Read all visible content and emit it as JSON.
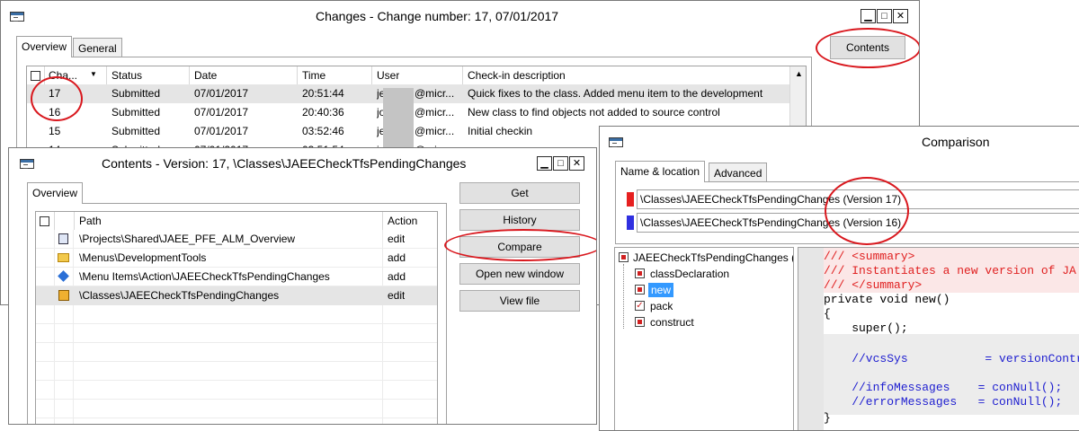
{
  "changes_window": {
    "title": "Changes - Change number: 17, 07/01/2017",
    "tabs": [
      "Overview",
      "General"
    ],
    "contents_button": "Contents",
    "columns": [
      "Cha...",
      "Status",
      "Date",
      "Time",
      "User",
      "Check-in description"
    ],
    "rows": [
      {
        "change": "17",
        "status": "Submitted",
        "date": "07/01/2017",
        "time": "20:51:44",
        "user": "je",
        "user_domain": "@micr...",
        "description": "Quick fixes to the class. Added menu item to the development"
      },
      {
        "change": "16",
        "status": "Submitted",
        "date": "07/01/2017",
        "time": "20:40:36",
        "user": "jo",
        "user_domain": "@micr...",
        "description": "New class to find objects not added to source control"
      },
      {
        "change": "15",
        "status": "Submitted",
        "date": "07/01/2017",
        "time": "03:52:46",
        "user": "je",
        "user_domain": "@micr...",
        "description": "Initial checkin"
      },
      {
        "change": "14",
        "status": "Submitted",
        "date": "07/01/2017",
        "time": "03:51:54",
        "user": "je",
        "user_domain": "@micr...",
        "description": ""
      }
    ]
  },
  "contents_window": {
    "title": "Contents - Version: 17, \\Classes\\JAEECheckTfsPendingChanges",
    "tab": "Overview",
    "columns": [
      "Path",
      "Action"
    ],
    "rows": [
      {
        "path": "\\Projects\\Shared\\JAEE_PFE_ALM_Overview",
        "action": "edit",
        "icon": "project-icon"
      },
      {
        "path": "\\Menus\\DevelopmentTools",
        "action": "add",
        "icon": "folder-icon"
      },
      {
        "path": "\\Menu Items\\Action\\JAEECheckTfsPendingChanges",
        "action": "add",
        "icon": "menu-item-action-icon"
      },
      {
        "path": "\\Classes\\JAEECheckTfsPendingChanges",
        "action": "edit",
        "icon": "class-icon"
      }
    ],
    "buttons": {
      "get": "Get",
      "history": "History",
      "compare": "Compare",
      "open_new_window": "Open new window",
      "view_file": "View file"
    }
  },
  "comparison_window": {
    "title": "Comparison",
    "tabs": [
      "Name & location",
      "Advanced"
    ],
    "fields": [
      {
        "value": "\\Classes\\JAEECheckTfsPendingChanges (Version 17)",
        "color": "#e62020"
      },
      {
        "value": "\\Classes\\JAEECheckTfsPendingChanges (Version 16)",
        "color": "#3030e0"
      }
    ],
    "tree": {
      "root": "JAEECheckTfsPendingChanges (V",
      "items": [
        "classDeclaration",
        "new",
        "pack",
        "construct"
      ],
      "selected": "new"
    },
    "code_lines": [
      {
        "text": "/// <summary>",
        "color": "#e02020",
        "band": "#fbe7e7"
      },
      {
        "text": "/// Instantiates a new version of JA",
        "color": "#e02020",
        "band": "#fbe7e7"
      },
      {
        "text": "/// </summary>",
        "color": "#e02020",
        "band": "#fbe7e7"
      },
      {
        "text": "private void new()",
        "color": "#000000",
        "band": ""
      },
      {
        "text": "{",
        "color": "#000000",
        "band": ""
      },
      {
        "text": "    super();",
        "color": "#000000",
        "band": ""
      },
      {
        "text": "",
        "color": "#000000",
        "band": "#e8e8e8"
      },
      {
        "text": "    //vcsSys           = versionContr",
        "color": "#2020d0",
        "band": "#e8e8e8"
      },
      {
        "text": "",
        "color": "#000000",
        "band": "#e8e8e8"
      },
      {
        "text": "    //infoMessages    = conNull();",
        "color": "#2020d0",
        "band": "#e8e8e8"
      },
      {
        "text": "    //errorMessages   = conNull();",
        "color": "#2020d0",
        "band": "#e8e8e8"
      },
      {
        "text": "}",
        "color": "#000000",
        "band": ""
      }
    ]
  }
}
